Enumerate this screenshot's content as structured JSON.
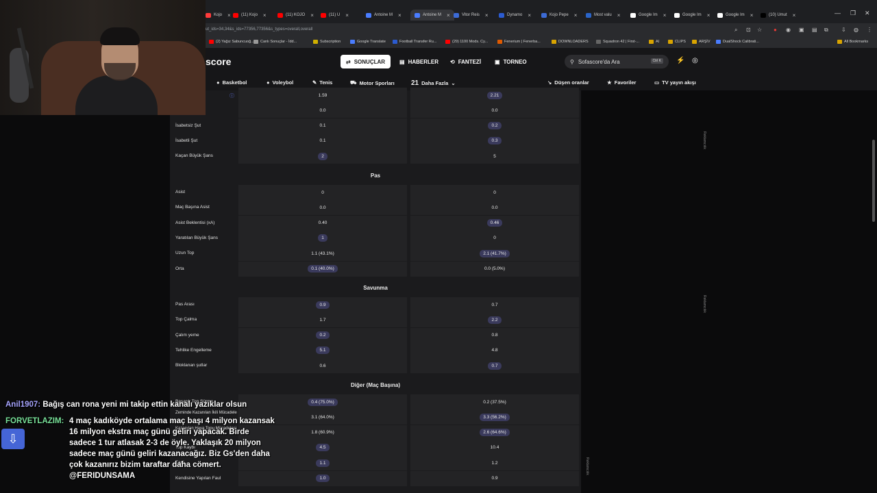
{
  "browser": {
    "tabs": [
      {
        "label": "Kojo",
        "color": "#ff3b3b"
      },
      {
        "label": "(11) Kojo",
        "color": "#ff0000"
      },
      {
        "label": "(11) KOJO",
        "color": "#ff0000"
      },
      {
        "label": "(11) U",
        "color": "#ff0000"
      },
      {
        "label": "Antoine M",
        "color": "#4a7dff"
      },
      {
        "label": "Antoine M",
        "color": "#4a7dff"
      },
      {
        "label": "Vitor Reis",
        "color": "#3c6bd6"
      },
      {
        "label": "Dynamo",
        "color": "#2b5bd0"
      },
      {
        "label": "Kojo Pepe",
        "color": "#3c6bd6"
      },
      {
        "label": "Most valu",
        "color": "#2a64c8"
      },
      {
        "label": "Google Im",
        "color": "#ffffff"
      },
      {
        "label": "Google Im",
        "color": "#ffffff"
      },
      {
        "label": "Google Im",
        "color": "#ffffff"
      },
      {
        "label": "(10) Umut",
        "color": "#000000"
      }
    ],
    "url": "ut_ids=34,34&s_ids=77356,77356&s_types=overall,overall",
    "bookmarks": [
      "(2) Yağız Sabuncuoğ...",
      "Canlı Sonuçlar - İdd...",
      "Subscription",
      "Google Translate",
      "Football Transfer Ru...",
      "(29) 1100 Mods. Cy...",
      "Fenerium | Fenerba...",
      "DOWNLOADERS",
      "Squadron 42 | First-...",
      "AI",
      "CLIPS",
      "ARŞİV",
      "DualShock Calibrati...",
      "All Bookmarks"
    ]
  },
  "site": {
    "logo": "score",
    "nav": [
      "SONUÇLAR",
      "HABERLER",
      "FANTEZİ",
      "TORNEO"
    ],
    "search_placeholder": "Sofascore'da Ara",
    "search_kbd": "Ctrl K",
    "sports": [
      "Basketbol",
      "Voleybol",
      "Tenis",
      "Motor Sporları"
    ],
    "more_count": "21",
    "more_label": "Daha Fazla",
    "right_links": [
      "Düşen oranlar",
      "Favoriler",
      "TV yayın akışı"
    ]
  },
  "stats": {
    "top_rows": [
      {
        "label": "",
        "left": "1.59",
        "right": "2.21",
        "hl": "right"
      },
      {
        "label": "",
        "left": "0.0",
        "right": "0.0",
        "hl": ""
      },
      {
        "label": "İsabetsiz Şut",
        "left": "0.1",
        "right": "0.2",
        "hl": "right"
      },
      {
        "label": "İsabetli Şut",
        "left": "0.1",
        "right": "0.3",
        "hl": "right"
      },
      {
        "label": "Kaçan Büyük Şans",
        "left": "2",
        "right": "5",
        "hl": "left"
      }
    ],
    "pas_title": "Pas",
    "pas_rows": [
      {
        "label": "Asist",
        "left": "0",
        "right": "0",
        "hl": ""
      },
      {
        "label": "Maç Başına Asist",
        "left": "0.0",
        "right": "0.0",
        "hl": ""
      },
      {
        "label": "Asist Beklentisi (xA)",
        "left": "0.40",
        "right": "0.46",
        "hl": "right"
      },
      {
        "label": "Yaratılan Büyük Şans",
        "left": "1",
        "right": "0",
        "hl": "left"
      },
      {
        "label": "Uzun Top",
        "left": "1.1 (43.1%)",
        "right": "2.1 (41.7%)",
        "hl": "right"
      },
      {
        "label": "Orta",
        "left": "0.1 (40.0%)",
        "right": "0.0 (5.0%)",
        "hl": "left"
      }
    ],
    "savunma_title": "Savunma",
    "savunma_rows": [
      {
        "label": "Pas Arası",
        "left": "0.9",
        "right": "0.7",
        "hl": "left"
      },
      {
        "label": "Top Çalma",
        "left": "1.7",
        "right": "2.2",
        "hl": "right"
      },
      {
        "label": "Çalım yeme",
        "left": "0.2",
        "right": "0.8",
        "hl": "left"
      },
      {
        "label": "Tehlike Engelleme",
        "left": "5.1",
        "right": "4.8",
        "hl": "left"
      },
      {
        "label": "Bloklanan şutlar",
        "left": "0.6",
        "right": "0.7",
        "hl": "right"
      }
    ],
    "diger_title": "Diğer (Maç Başına)",
    "diger_rows": [
      {
        "label": "Başarılı Top Sürme",
        "left": "0.4 (75.0%)",
        "right": "0.2 (37.5%)",
        "hl": "left"
      },
      {
        "label": "Zeminde Kazanılan İkili Mücadele",
        "left": "3.1 (64.0%)",
        "right": "3.3 (56.2%)",
        "hl": "right"
      },
      {
        "label": "Kazanılan Hava Topu Mücadelesi",
        "left": "1.8 (60.9%)",
        "right": "2.6 (64.6%)",
        "hl": "right"
      },
      {
        "label": "Top Kaybı",
        "left": "4.5",
        "right": "10.4",
        "hl": "left"
      },
      {
        "label": "Faul",
        "left": "1.1",
        "right": "1.2",
        "hl": "left"
      },
      {
        "label": "Kendisine Yapılan Faul",
        "left": "1.0",
        "right": "0.9",
        "hl": "left"
      }
    ],
    "ad_label": "Reklamcılık"
  },
  "chat": [
    {
      "user": "Anil1907:",
      "text": "Bağış can rona yeni mi takip ettin kanalı yazıklar olsun"
    },
    {
      "user": "FORVETLAZIM:",
      "text": "4 maç kadıköyde ortalama maç başı 4 milyon kazansak 16 milyon ekstra maç günü geliri yapacak. Birde sadece 1 tur atlasak 2-3 de öyle. Yaklaşık 20 milyon sadece maç günü geliri kazanacağız. Biz Gs'den daha çok kazanırız bizim taraftar daha cömert. @FERIDUNSAMA"
    }
  ]
}
